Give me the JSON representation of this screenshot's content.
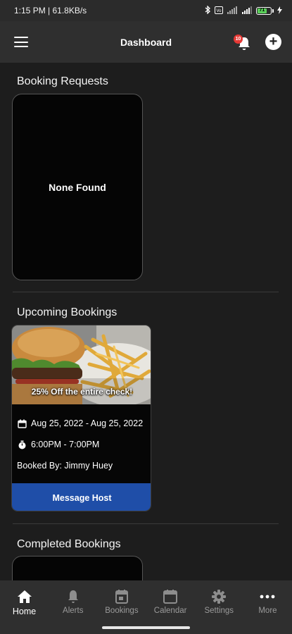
{
  "status_bar": {
    "time_text": "1:15 PM | 61.8KB/s",
    "battery_level": "71",
    "icons": [
      "bluetooth-icon",
      "vo-icon",
      "signal-icon",
      "signal-icon",
      "battery-icon",
      "charging-icon"
    ]
  },
  "header": {
    "title": "Dashboard",
    "notification_count": "10",
    "icons": {
      "menu": "hamburger-menu-icon",
      "notifications": "bell-icon",
      "add": "add-circle-icon"
    }
  },
  "sections": {
    "booking_requests": {
      "title": "Booking Requests",
      "empty_text": "None Found"
    },
    "upcoming_bookings": {
      "title": "Upcoming Bookings",
      "card": {
        "promo_text": "25% Off the entire check!",
        "date_range": "Aug 25, 2022 - Aug 25, 2022",
        "time_range": "6:00PM - 7:00PM",
        "booked_by": "Booked By: Jimmy Huey",
        "action_label": "Message Host"
      }
    },
    "completed_bookings": {
      "title": "Completed Bookings"
    }
  },
  "bottom_nav": {
    "active": "Home",
    "items": [
      {
        "label": "Home",
        "icon": "home-icon"
      },
      {
        "label": "Alerts",
        "icon": "bell-icon"
      },
      {
        "label": "Bookings",
        "icon": "bookings-icon"
      },
      {
        "label": "Calendar",
        "icon": "calendar-icon"
      },
      {
        "label": "Settings",
        "icon": "gear-icon"
      },
      {
        "label": "More",
        "icon": "more-dots-icon"
      }
    ]
  },
  "colors": {
    "background": "#1d1d1d",
    "header": "#2f2f2f",
    "card": "#050505",
    "button_blue": "#1f4ea8",
    "badge_red": "#e53935",
    "battery_green": "#5bd15b"
  }
}
